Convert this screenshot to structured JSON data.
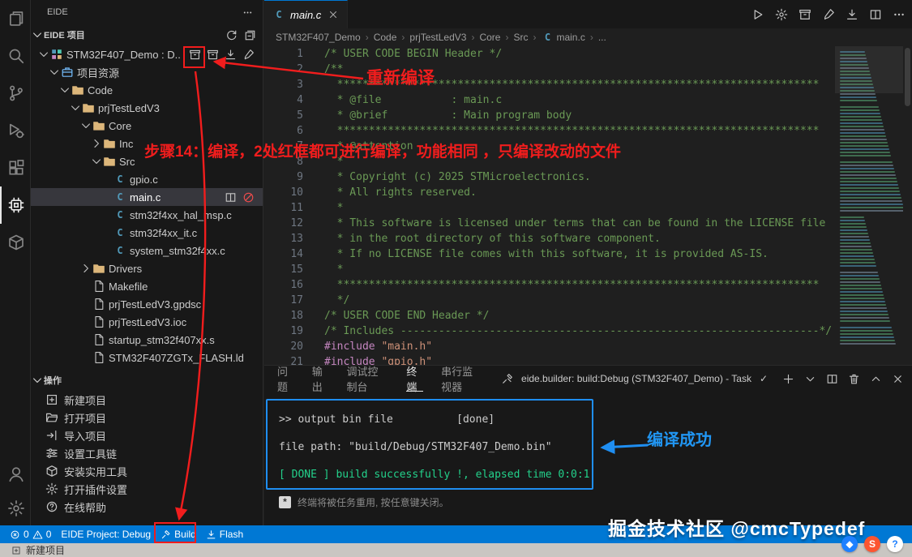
{
  "colors": {
    "accent": "#0078d4",
    "annotation_red": "#f11d1d",
    "annotation_blue": "#2196f3",
    "comment_green": "#6A9955",
    "preprocessor": "#C586C0",
    "string_orange": "#CE9178",
    "terminal_green": "#23d18b",
    "folder_tan": "#dcb67a",
    "c_blue": "#519aba"
  },
  "activity_bar": {
    "items": [
      {
        "name": "explorer",
        "icon": "files-icon"
      },
      {
        "name": "search",
        "icon": "search-icon"
      },
      {
        "name": "source-control",
        "icon": "git-branch-icon"
      },
      {
        "name": "run-and-debug",
        "icon": "run-debug-icon"
      },
      {
        "name": "extensions",
        "icon": "extensions-icon"
      },
      {
        "name": "eide",
        "icon": "chip-icon",
        "active": true
      },
      {
        "name": "serial-monitor",
        "icon": "package-icon"
      }
    ],
    "bottom": [
      {
        "name": "account",
        "icon": "account-icon"
      },
      {
        "name": "settings",
        "icon": "gear-icon"
      }
    ]
  },
  "sidebar": {
    "title": "EIDE",
    "section_projects": "EIDE 项目",
    "section_ops": "操作",
    "tree": [
      {
        "label": "STM32F407_Demo : D..",
        "level": 0,
        "icon": "project-icon",
        "chevron": "down",
        "actions": [
          "build-icon",
          "rebuild-icon",
          "flash-download-icon",
          "clean-brush-icon"
        ]
      },
      {
        "label": "项目资源",
        "level": 1,
        "icon": "resources-icon",
        "chevron": "down"
      },
      {
        "label": "Code",
        "level": 2,
        "icon": "folder-icon",
        "chevron": "down"
      },
      {
        "label": "prjTestLedV3",
        "level": 3,
        "icon": "folder-icon",
        "chevron": "down"
      },
      {
        "label": "Core",
        "level": 4,
        "icon": "folder-icon",
        "chevron": "down"
      },
      {
        "label": "Inc",
        "level": 5,
        "icon": "folder-icon",
        "chevron": "right"
      },
      {
        "label": "Src",
        "level": 5,
        "icon": "folder-icon",
        "chevron": "down"
      },
      {
        "label": "gpio.c",
        "level": 6,
        "icon": "c-file-icon"
      },
      {
        "label": "main.c",
        "level": 6,
        "icon": "c-file-icon",
        "selected": true,
        "actions": [
          "split-editor-icon",
          "circle-slash-icon"
        ]
      },
      {
        "label": "stm32f4xx_hal_msp.c",
        "level": 6,
        "icon": "c-file-icon"
      },
      {
        "label": "stm32f4xx_it.c",
        "level": 6,
        "icon": "c-file-icon"
      },
      {
        "label": "system_stm32f4xx.c",
        "level": 6,
        "icon": "c-file-icon"
      },
      {
        "label": "Drivers",
        "level": 4,
        "icon": "folder-icon",
        "chevron": "right"
      },
      {
        "label": "Makefile",
        "level": 4,
        "icon": "file-icon"
      },
      {
        "label": "prjTestLedV3.gpdsc",
        "level": 4,
        "icon": "file-icon"
      },
      {
        "label": "prjTestLedV3.ioc",
        "level": 4,
        "icon": "file-icon"
      },
      {
        "label": "startup_stm32f407xx.s",
        "level": 4,
        "icon": "file-icon"
      },
      {
        "label": "STM32F407ZGTx_FLASH.ld",
        "level": 4,
        "icon": "file-icon"
      }
    ],
    "operations": [
      {
        "label": "新建项目",
        "icon": "new-project-icon"
      },
      {
        "label": "打开项目",
        "icon": "folder-open-icon"
      },
      {
        "label": "导入项目",
        "icon": "import-icon"
      },
      {
        "label": "设置工具链",
        "icon": "sliders-icon"
      },
      {
        "label": "安装实用工具",
        "icon": "package-icon"
      },
      {
        "label": "打开插件设置",
        "icon": "gear-icon"
      },
      {
        "label": "在线帮助",
        "icon": "question-icon"
      }
    ]
  },
  "editor": {
    "tab": {
      "label": "main.c"
    },
    "actions": [
      "play-icon",
      "gear-icon",
      "build-icon",
      "clean-brush-icon",
      "flash-download-icon",
      "split-editor-icon",
      "ellipsis-icon"
    ],
    "breadcrumb": [
      {
        "label": "STM32F407_Demo"
      },
      {
        "label": "Code"
      },
      {
        "label": "prjTestLedV3"
      },
      {
        "label": "Core"
      },
      {
        "label": "Src"
      },
      {
        "label": "main.c",
        "icon": "c-file-icon"
      },
      {
        "label": "..."
      }
    ],
    "code_lines": [
      {
        "n": "1",
        "t": [
          [
            "com",
            "/* USER CODE BEGIN Header */"
          ]
        ]
      },
      {
        "n": "2",
        "t": [
          [
            "com",
            "/**"
          ]
        ]
      },
      {
        "n": "3",
        "t": [
          [
            "com",
            "  ****************************************************************************"
          ]
        ]
      },
      {
        "n": "4",
        "t": [
          [
            "com",
            "  * @file           : main.c"
          ]
        ]
      },
      {
        "n": "5",
        "t": [
          [
            "com",
            "  * @brief          : Main program body"
          ]
        ]
      },
      {
        "n": "6",
        "t": [
          [
            "com",
            "  ****************************************************************************"
          ]
        ]
      },
      {
        "n": "7",
        "t": [
          [
            "com",
            "  * @attention"
          ]
        ]
      },
      {
        "n": "8",
        "t": [
          [
            "com",
            "  *"
          ]
        ]
      },
      {
        "n": "9",
        "t": [
          [
            "com",
            "  * Copyright (c) 2025 STMicroelectronics."
          ]
        ]
      },
      {
        "n": "10",
        "t": [
          [
            "com",
            "  * All rights reserved."
          ]
        ]
      },
      {
        "n": "11",
        "t": [
          [
            "com",
            "  *"
          ]
        ]
      },
      {
        "n": "12",
        "t": [
          [
            "com",
            "  * This software is licensed under terms that can be found in the LICENSE file"
          ]
        ]
      },
      {
        "n": "13",
        "t": [
          [
            "com",
            "  * in the root directory of this software component."
          ]
        ]
      },
      {
        "n": "14",
        "t": [
          [
            "com",
            "  * If no LICENSE file comes with this software, it is provided AS-IS."
          ]
        ]
      },
      {
        "n": "15",
        "t": [
          [
            "com",
            "  *"
          ]
        ]
      },
      {
        "n": "16",
        "t": [
          [
            "com",
            "  ****************************************************************************"
          ]
        ]
      },
      {
        "n": "17",
        "t": [
          [
            "com",
            "  */"
          ]
        ]
      },
      {
        "n": "18",
        "t": [
          [
            "com",
            "/* USER CODE END Header */"
          ]
        ]
      },
      {
        "n": "19",
        "t": [
          [
            "com",
            "/* Includes ------------------------------------------------------------------*/"
          ]
        ]
      },
      {
        "n": "20",
        "t": [
          [
            "pre",
            "#include"
          ],
          [
            "pl",
            " "
          ],
          [
            "str",
            "\"main.h\""
          ]
        ]
      },
      {
        "n": "21",
        "t": [
          [
            "pre",
            "#include"
          ],
          [
            "pl",
            " "
          ],
          [
            "str",
            "\"gpio.h\""
          ]
        ]
      }
    ]
  },
  "panel": {
    "tabs": [
      {
        "label": "问题"
      },
      {
        "label": "输出"
      },
      {
        "label": "调试控制台"
      },
      {
        "label": "终端",
        "active": true
      },
      {
        "label": "串行监视器"
      }
    ],
    "task_label": "eide.builder: build:Debug (STM32F407_Demo) - Task",
    "task_check": "✓",
    "action_icons": [
      "plus-icon",
      "chevron-down-icon",
      "split-editor-icon",
      "trash-icon",
      "chevron-up-icon",
      "close-icon"
    ],
    "terminal_lines": [
      {
        "text": ">> output bin file          [done]",
        "color": "default"
      },
      {
        "text": "",
        "color": "default"
      },
      {
        "text": "file path: \"build/Debug/STM32F407_Demo.bin\"",
        "color": "default"
      },
      {
        "text": "",
        "color": "default"
      },
      {
        "text": "[ DONE ] build successfully !, elapsed time 0:0:1",
        "color": "green"
      }
    ],
    "note_badge": "*",
    "reuse_message": "终端将被任务重用, 按任意键关闭。"
  },
  "status_bar": {
    "errors": "0",
    "warnings": "0",
    "project_label": "EIDE Project: Debug",
    "build_label": "Build",
    "flash_label": "Flash"
  },
  "bottom_strip": {
    "label": "新建项目"
  },
  "annotations": {
    "recompile_label": "重新编译",
    "step_label": "步骤14：编译，2处红框都可进行编译，功能相同 ，只编译改动的文件",
    "success_label": "编译成功",
    "watermark": "掘金技术社区 @cmcTypedef"
  },
  "floating_badges": [
    {
      "name": "juejin-badge",
      "text": "◆",
      "bg": "#1e80ff",
      "fg": "#ffffff"
    },
    {
      "name": "csdn-badge",
      "text": "S",
      "bg": "#fc5531",
      "fg": "#ffffff"
    },
    {
      "name": "help-badge",
      "text": "?",
      "bg": "#ffffff",
      "fg": "#1e80ff"
    }
  ]
}
